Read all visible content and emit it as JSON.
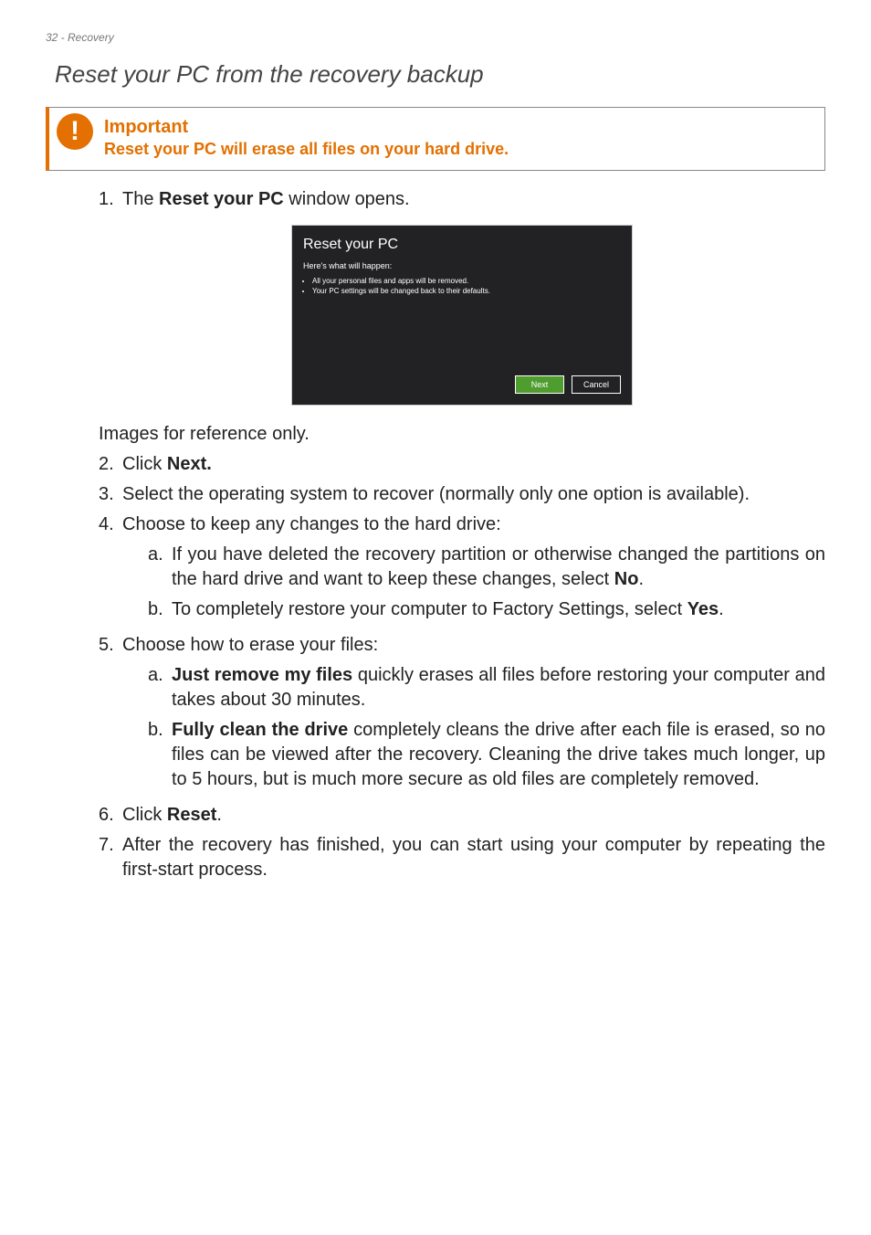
{
  "header": "32 - Recovery",
  "section_title": "Reset your PC from the recovery backup",
  "important": {
    "title": "Important",
    "body": "Reset your PC will erase all files on your hard drive."
  },
  "screenshot": {
    "title": "Reset your PC",
    "subtitle": "Here's what will happen:",
    "bullets": [
      "All your personal files and apps will be removed.",
      "Your PC settings will be changed back to their defaults."
    ],
    "next": "Next",
    "cancel": "Cancel"
  },
  "note_images": "Images for reference only.",
  "steps": {
    "s1_a": "The ",
    "s1_b": "Reset your PC",
    "s1_c": " window opens.",
    "s2_a": "Click ",
    "s2_b": "Next.",
    "s3": "Select the operating system to recover (normally only one option is available).",
    "s4": "Choose to keep any changes to the hard drive:",
    "s4a_a": "If you have deleted the recovery partition or otherwise changed the partitions on the hard drive and want to keep these changes, select ",
    "s4a_b": "No",
    "s4a_c": ".",
    "s4b_a": "To completely restore your computer to Factory Settings, select ",
    "s4b_b": "Yes",
    "s4b_c": ".",
    "s5": "Choose how to erase your files:",
    "s5a_b": "Just remove my files",
    "s5a_a": " quickly erases all files before restoring your computer and takes about 30 minutes.",
    "s5b_b": "Fully clean the drive",
    "s5b_a": " completely cleans the drive after each file is erased, so no files can be viewed after the recovery. Cleaning the drive takes much longer, up to 5 hours, but is much more secure as old files are completely removed.",
    "s6_a": "Click ",
    "s6_b": "Reset",
    "s6_c": ".",
    "s7": "After the recovery has finished, you can start using your computer by repeating the first-start process."
  },
  "markers": {
    "m1": "1.",
    "m2": "2.",
    "m3": "3.",
    "m4": "4.",
    "m5": "5.",
    "m6": "6.",
    "m7": "7.",
    "ma": "a.",
    "mb": "b."
  }
}
